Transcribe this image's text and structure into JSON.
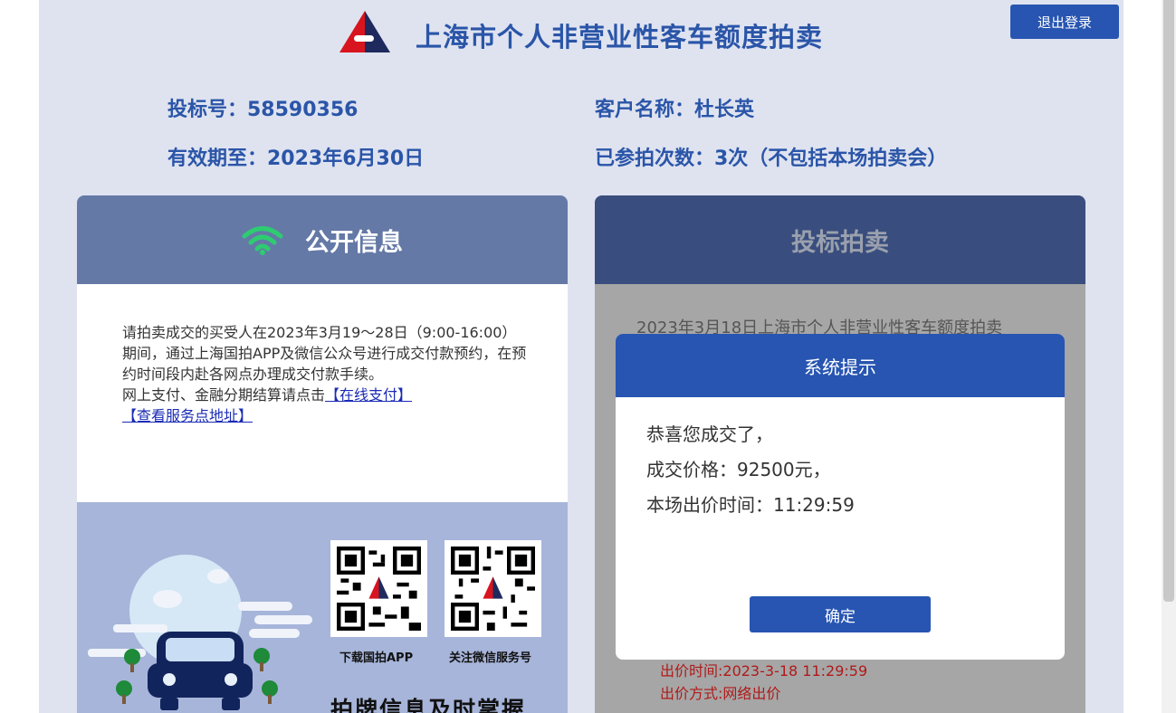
{
  "header": {
    "title": "上海市个人非营业性客车额度拍卖",
    "logout_label": "退出登录"
  },
  "bidder": {
    "bid_number": "投标号：58590356",
    "valid_until": "有效期至：2023年6月30日",
    "customer_name": "客户名称：杜长英",
    "participation_count": "已参拍次数：3次（不包括本场拍卖会）"
  },
  "public_info": {
    "heading": "公开信息",
    "notice_text": "请拍卖成交的买受人在2023年3月19～28日（9:00-16:00）期间，通过上海国拍APP及微信公众号进行成交付款预约，在预约时间段内赴各网点办理成交付款手续。",
    "online_pay_prefix": "网上支付、金融分期结算请点击",
    "online_pay_link": "【在线支付】",
    "service_points_link": "【查看服务点地址】",
    "qr_app_caption": "下载国拍APP",
    "qr_wechat_caption": "关注微信服务号",
    "promo_title": "拍牌信息及时掌握"
  },
  "bidding": {
    "heading": "投标拍卖",
    "auction_line": "2023年3月18日上海市个人非营业性客车额度拍卖",
    "bid_time": "出价时间:2023-3-18 11:29:59",
    "bid_method": "出价方式:网络出价"
  },
  "modal": {
    "title": "系统提示",
    "line1": "恭喜您成交了，",
    "line2": "成交价格：92500元，",
    "line3": "本场出价时间：11:29:59",
    "ok_label": "确定"
  },
  "colors": {
    "brand_blue": "#2755b1",
    "page_bg": "#dfe3f0",
    "wifi_green": "#2ecc71",
    "bid_red": "#b01a1a"
  }
}
